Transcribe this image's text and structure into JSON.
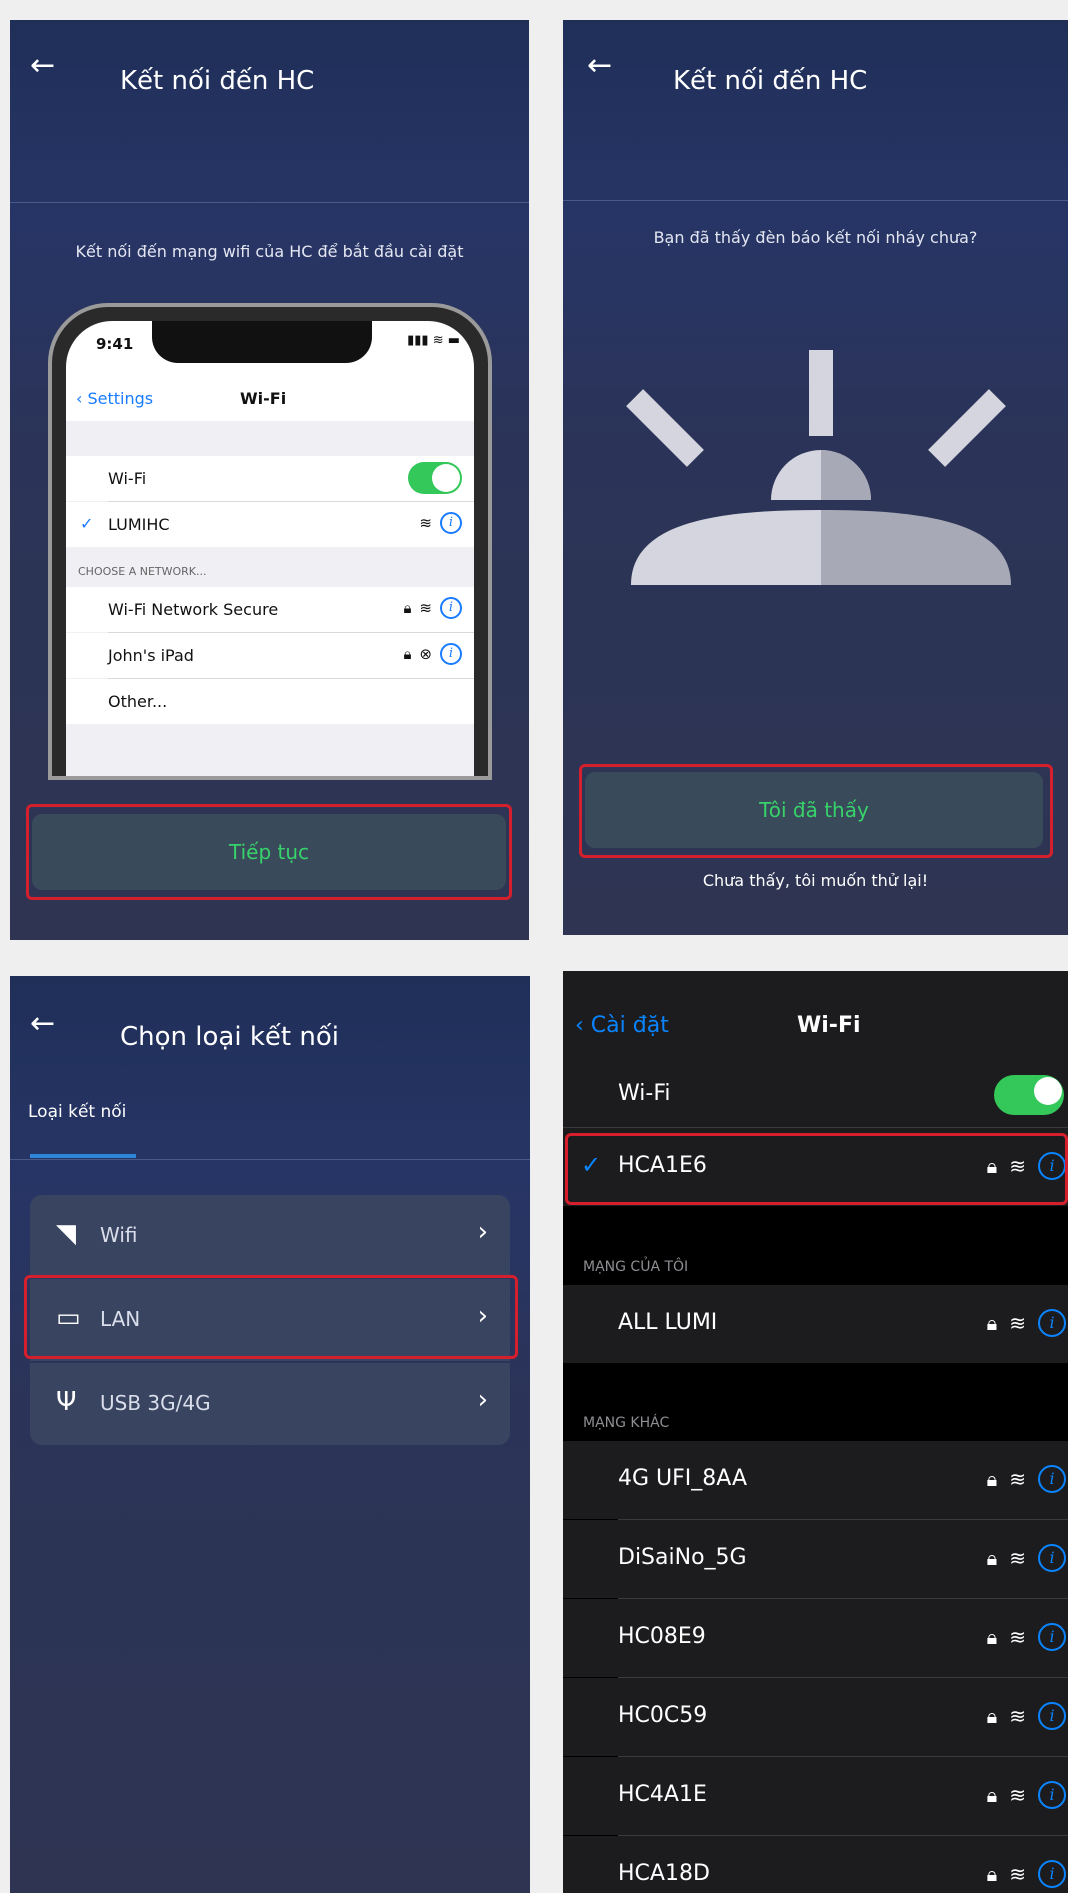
{
  "panel1": {
    "title": "Kết nối đến HC",
    "subtitle": "Kết nối đến mạng wifi của HC để bắt đầu cài đặt",
    "phone": {
      "time": "9:41",
      "back_label": "Settings",
      "title": "Wi-Fi",
      "wifi_label": "Wi-Fi",
      "connected": "LUMIHC",
      "section": "CHOOSE A NETWORK...",
      "networks": [
        "Wi-Fi Network Secure",
        "John's iPad",
        "Other..."
      ]
    },
    "button": "Tiếp tục"
  },
  "panel2": {
    "title": "Kết nối đến HC",
    "subtitle": "Bạn đã thấy đèn báo kết nối nháy chưa?",
    "button": "Tôi đã thấy",
    "retry": "Chưa thấy, tôi muốn thử lại!"
  },
  "panel3": {
    "title": "Chọn loại kết nối",
    "tab": "Loại kết nối",
    "options": [
      "Wifi",
      "LAN",
      "USB 3G/4G"
    ]
  },
  "panel4": {
    "back_label": "Cài đặt",
    "title": "Wi-Fi",
    "wifi_label": "Wi-Fi",
    "connected": "HCA1E6",
    "my_networks_label": "MẠNG CỦA TÔI",
    "my_networks": [
      "ALL LUMI"
    ],
    "other_networks_label": "MẠNG KHÁC",
    "other_networks": [
      "4G UFI_8AA",
      "DiSaiNo_5G",
      "HC08E9",
      "HC0C59",
      "HC4A1E",
      "HCA18D"
    ]
  },
  "colors": {
    "accent_green": "#37d36a",
    "highlight_red": "#d61f2c",
    "ios_blue": "#0a84ff"
  }
}
